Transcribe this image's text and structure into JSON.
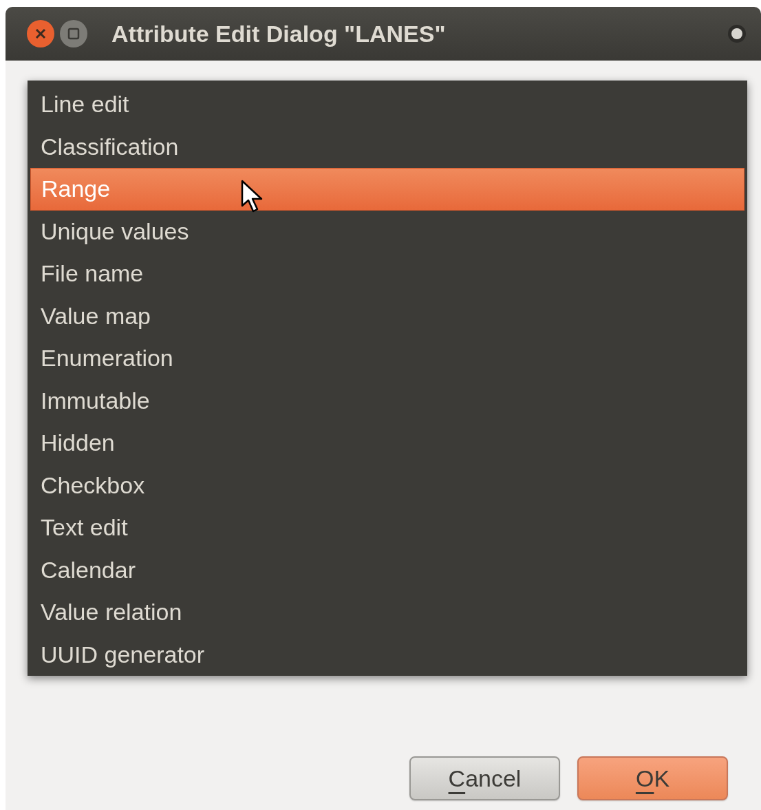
{
  "window": {
    "title": "Attribute Edit Dialog \"LANES\""
  },
  "list": {
    "items": [
      {
        "label": "Line edit",
        "selected": false
      },
      {
        "label": "Classification",
        "selected": false
      },
      {
        "label": "Range",
        "selected": true
      },
      {
        "label": "Unique values",
        "selected": false
      },
      {
        "label": "File name",
        "selected": false
      },
      {
        "label": "Value map",
        "selected": false
      },
      {
        "label": "Enumeration",
        "selected": false
      },
      {
        "label": "Immutable",
        "selected": false
      },
      {
        "label": "Hidden",
        "selected": false
      },
      {
        "label": "Checkbox",
        "selected": false
      },
      {
        "label": "Text edit",
        "selected": false
      },
      {
        "label": "Calendar",
        "selected": false
      },
      {
        "label": "Value relation",
        "selected": false
      },
      {
        "label": "UUID generator",
        "selected": false
      }
    ]
  },
  "buttons": [
    {
      "label": "Cancel",
      "kind": "normal",
      "mnemonic_underlined": true
    },
    {
      "label": "OK",
      "kind": "default",
      "mnemonic_underlined": true
    }
  ]
}
